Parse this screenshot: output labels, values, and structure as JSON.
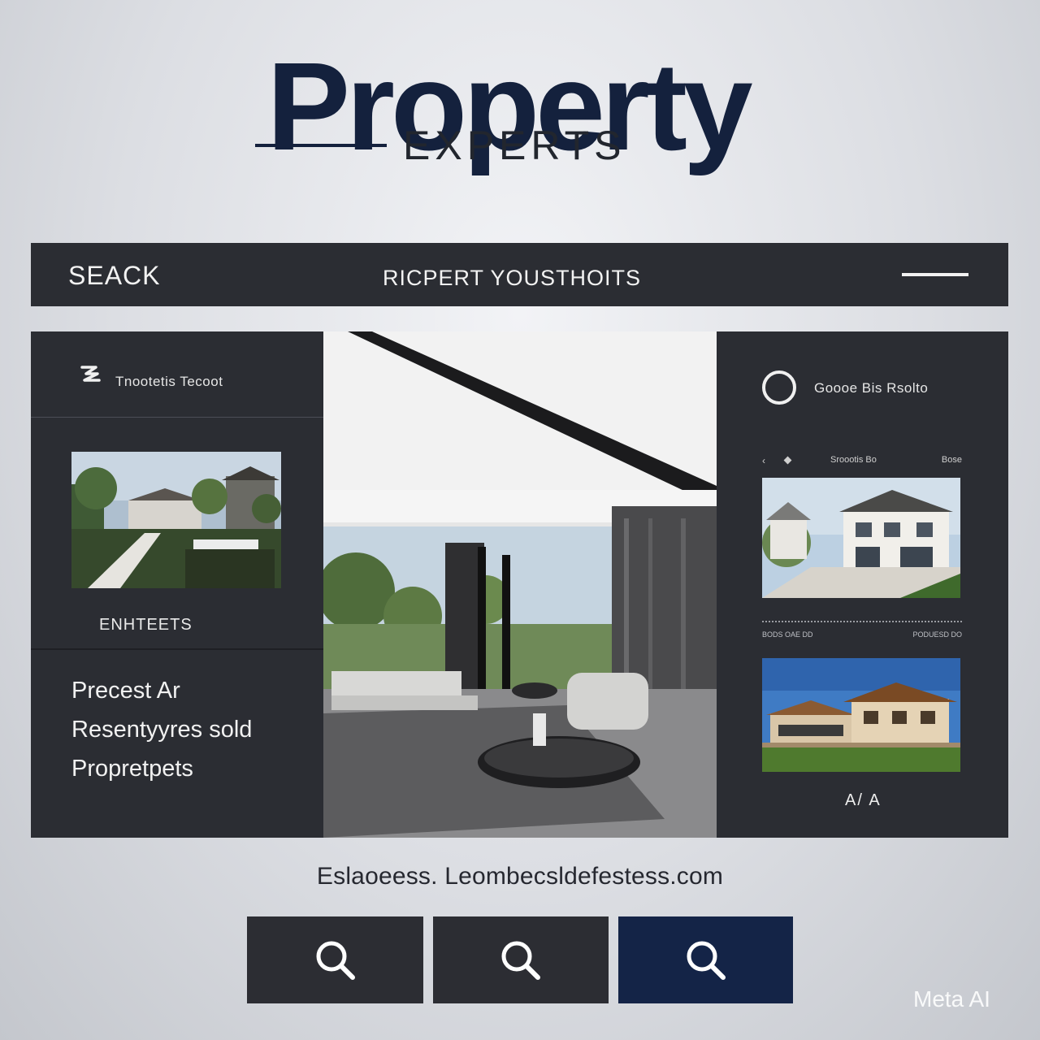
{
  "brand": {
    "title": "Property",
    "subtitle": "EXPERTS"
  },
  "searchbar": {
    "search_label": "SEACK",
    "tagline": "RICPERT YOUSTHOITS",
    "menu_icon": "menu-line-icon"
  },
  "left_panel": {
    "header_text": "Tnootetis Tecoot",
    "header_icon": "logo-mark-icon",
    "listing_label": "ENHTEETS",
    "lines": [
      "Precest Ar",
      "Resentyyres sold",
      "Propretpets"
    ]
  },
  "right_panel": {
    "header_text": "Goooe Bis Rsolto",
    "header_icon": "ring-icon",
    "nav_title": "Sroootis Bo",
    "nav_right": "Bose",
    "meta_left": "BODS OAE DD",
    "meta_right": "PODUESD DO",
    "mark": "A/ A"
  },
  "footer": {
    "url": "Eslaoeess. Leombecsldefestess.com"
  },
  "buttons": [
    {
      "icon": "search-icon"
    },
    {
      "icon": "search-icon"
    },
    {
      "icon": "search-icon"
    }
  ],
  "watermark": "Meta AI",
  "colors": {
    "navy": "#14213d",
    "panel": "#2b2d33",
    "active_button": "#142447"
  }
}
